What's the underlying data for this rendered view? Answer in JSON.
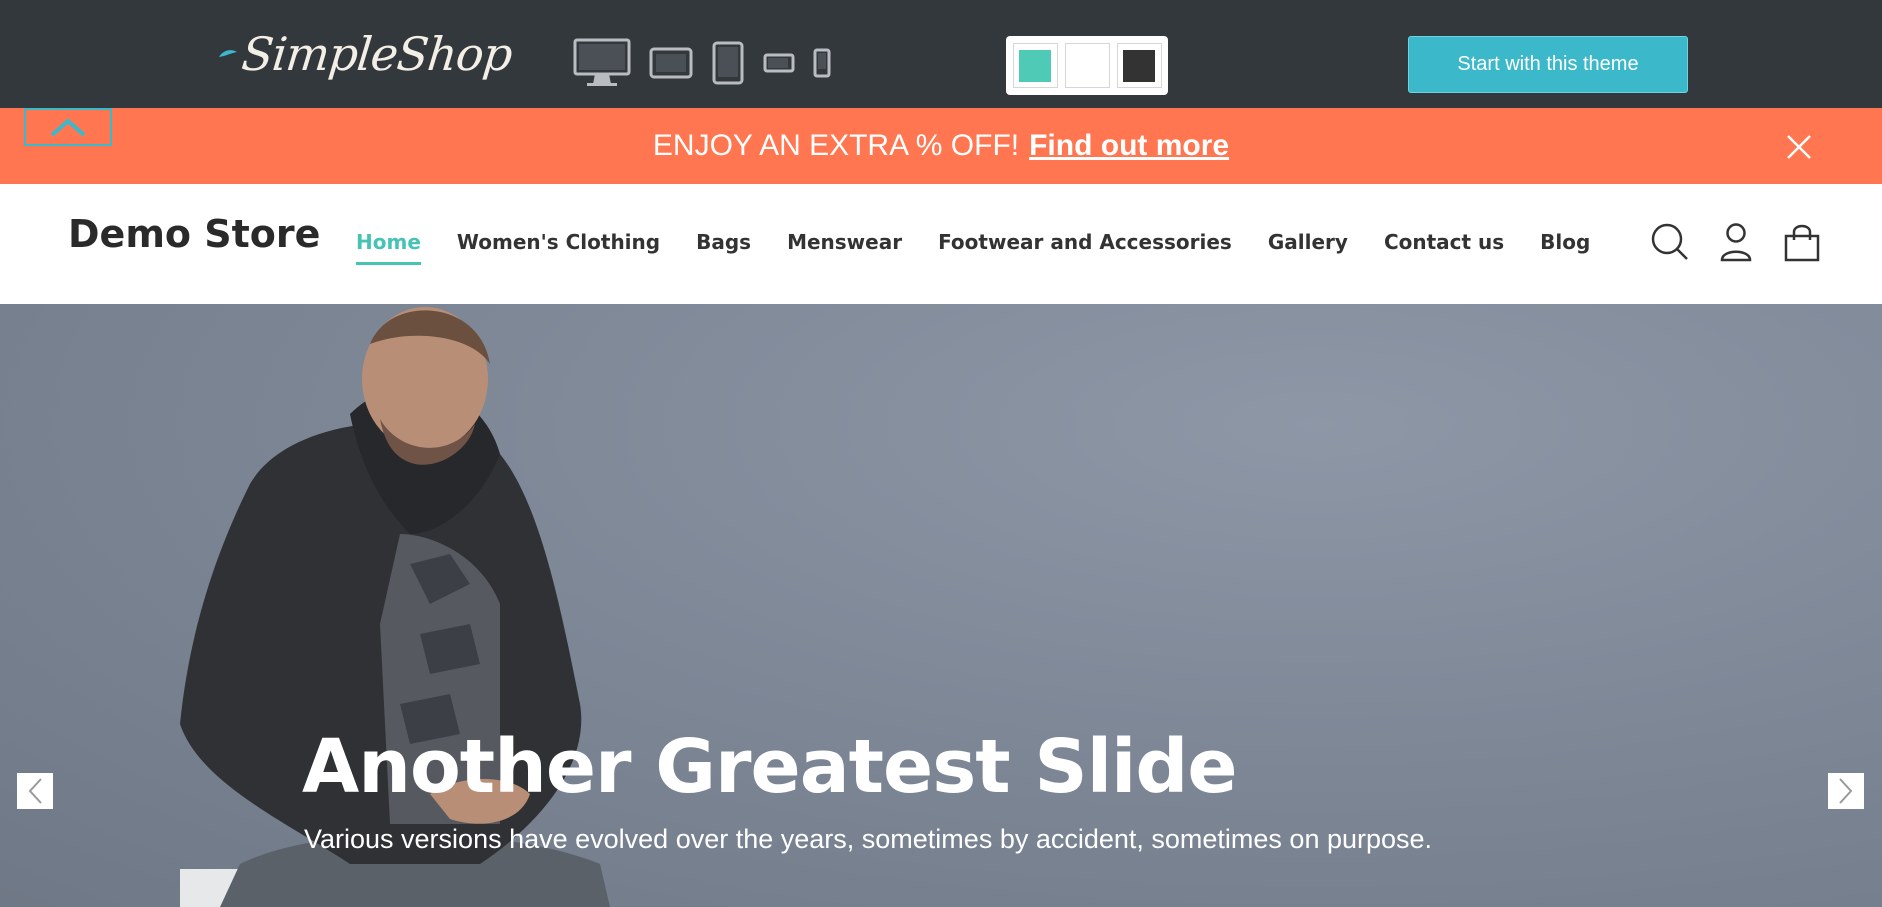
{
  "topbar": {
    "logo_text": "SimpleShop",
    "devices": [
      {
        "name": "desktop-icon"
      },
      {
        "name": "laptop-icon"
      },
      {
        "name": "tablet-icon"
      },
      {
        "name": "tablet-landscape-icon"
      },
      {
        "name": "phone-icon"
      }
    ],
    "swatches": [
      {
        "name": "teal",
        "color": "#4fcab6"
      },
      {
        "name": "white",
        "color": "#ffffff"
      },
      {
        "name": "dark",
        "color": "#333333"
      }
    ],
    "start_button": "Start with this theme",
    "accent": "#3bb8c9",
    "background": "#33383d"
  },
  "promo": {
    "text": "ENJOY AN EXTRA % OFF!",
    "link": "Find out more",
    "background": "#ff7650"
  },
  "header": {
    "store_name": "Demo Store",
    "nav": [
      {
        "label": "Home",
        "active": true
      },
      {
        "label": "Women's Clothing"
      },
      {
        "label": "Bags"
      },
      {
        "label": "Menswear"
      },
      {
        "label": "Footwear and Accessories"
      },
      {
        "label": "Gallery"
      },
      {
        "label": "Contact us"
      },
      {
        "label": "Blog"
      }
    ],
    "active_color": "#47c3b4",
    "icons": [
      "search-icon",
      "account-icon",
      "cart-icon"
    ]
  },
  "hero": {
    "title": "Another Greatest Slide",
    "subtitle": "Various versions have evolved over the years, sometimes by accident, sometimes on purpose."
  }
}
